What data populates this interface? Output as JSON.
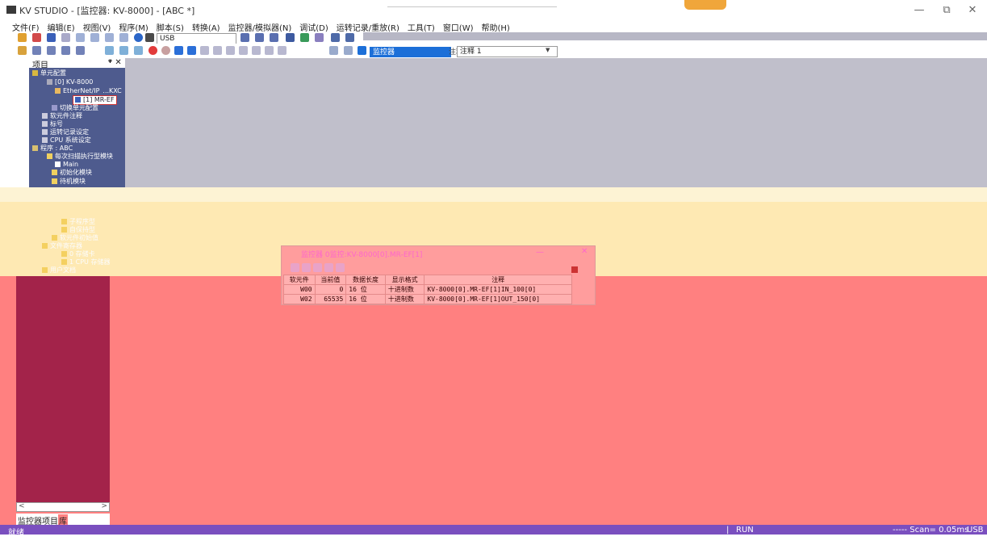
{
  "window": {
    "title": "KV STUDIO - [监控器: KV-8000] - [ABC *]",
    "min": "—",
    "max": "⧉",
    "close": "✕"
  },
  "menu": [
    "文件(F)",
    "编辑(E)",
    "视图(V)",
    "程序(M)",
    "脚本(S)",
    "转换(A)",
    "监控器/模拟器(N)",
    "调试(D)",
    "运转记录/重放(R)",
    "工具(T)",
    "窗口(W)",
    "帮助(H)"
  ],
  "toolbar": {
    "port": "USB",
    "mode": "监控器",
    "comment_label": "注释",
    "comment_value": "注释 1"
  },
  "project": {
    "title": "项目",
    "pin": "ᵠ ✕",
    "tree": {
      "unit_config": "单元配置",
      "cpu_unit": "[0]  KV-8000",
      "ethernet_ip": "EtherNet/IP",
      "ethernet_ip_suffix": "...KXC",
      "mr_ef": "[1]  MR-EF",
      "switch_unit": "切换单元配置",
      "device_comment": "软元件注释",
      "label": "标号",
      "ops_record": "运转记录设定",
      "cpu_setting": "CPU 系统设定",
      "program": "程序 : ABC",
      "scan_module": "每次扫描执行型模块",
      "main": "Main",
      "init_module": "初始化模块",
      "standby_module": "待机模块",
      "subroutine": "子程序型",
      "self_hold": "自保持型",
      "device_init": "软元件初始值",
      "file_register": "文件寄存器",
      "storage_card": "0 存储卡",
      "cpu_memory": "1 CPU 存储器",
      "user_doc": "用户文档"
    },
    "tabs": [
      "监控器",
      "项目",
      "库"
    ]
  },
  "monitor_window": {
    "title": "监控器 0监控:KV-8000[0].MR-EF[1]",
    "min": "—",
    "close": "✕",
    "columns": [
      "软元件",
      "当前值",
      "数据长度",
      "显示格式",
      "注释"
    ],
    "rows": [
      {
        "device": "W00",
        "value": "0",
        "len": "16 位",
        "format": "十进制数",
        "comment": "KV-8000[0].MR-EF[1]IN_100[0]"
      },
      {
        "device": "W02",
        "value": "65535",
        "len": "16 位",
        "format": "十进制数",
        "comment": "KV-8000[0].MR-EF[1]OUT_150[0]"
      }
    ]
  },
  "status": {
    "ready": "就绪",
    "mode": "RUN",
    "scan": "----- Scan= 0.05ms",
    "conn": "USB"
  },
  "colors": {
    "tree_bg": "#4e5b8e",
    "main_gray": "#c0bfcb",
    "main_red": "#ff8080",
    "status_bar": "#7a4fbf"
  }
}
